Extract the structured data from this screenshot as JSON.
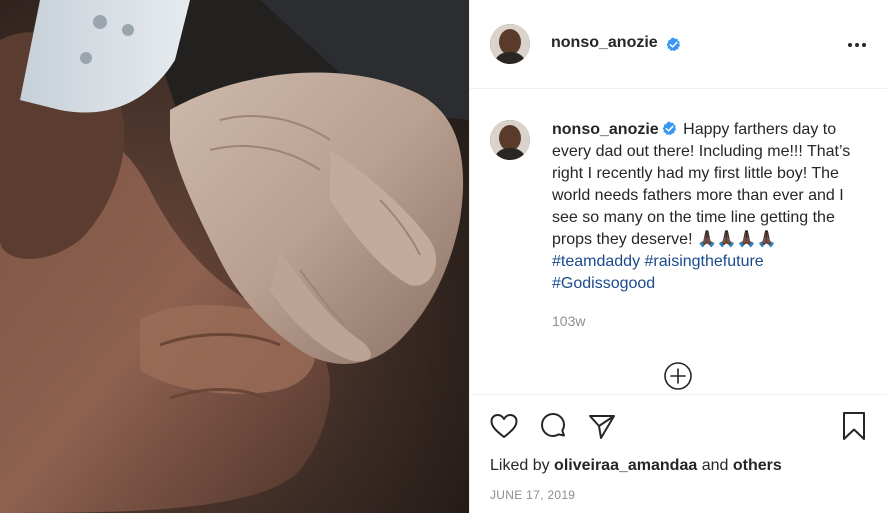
{
  "header": {
    "username": "nonso_anozie",
    "verified": true
  },
  "caption": {
    "username": "nonso_anozie",
    "text": "Happy farthers day to every dad out there! Including me!!! That’s right I recently had my first little boy! The world needs fathers more than ever and I see so many on the time line getting the props they deserve! ",
    "emoji": "🙏🏿🙏🏿🙏🏿🙏🏿",
    "hashtags": [
      "#teamdaddy",
      "#raisingthefuture",
      "#Godissogood"
    ],
    "time_ago": "103w"
  },
  "likes": {
    "prefix": "Liked by",
    "user": "oliveiraa_amandaa",
    "connector": "and",
    "others": "others"
  },
  "date": "JUNE 17, 2019",
  "icons": {
    "more": "more-options-icon",
    "like": "heart-icon",
    "comment": "comment-bubble-icon",
    "share": "paper-plane-icon",
    "save": "bookmark-icon",
    "load_more": "plus-circle-icon",
    "verified": "verified-badge-icon"
  },
  "colors": {
    "verified_badge": "#3897f0",
    "hashtag": "#1a4b8c",
    "muted_text": "#8e8e8e",
    "border": "#efefef"
  }
}
